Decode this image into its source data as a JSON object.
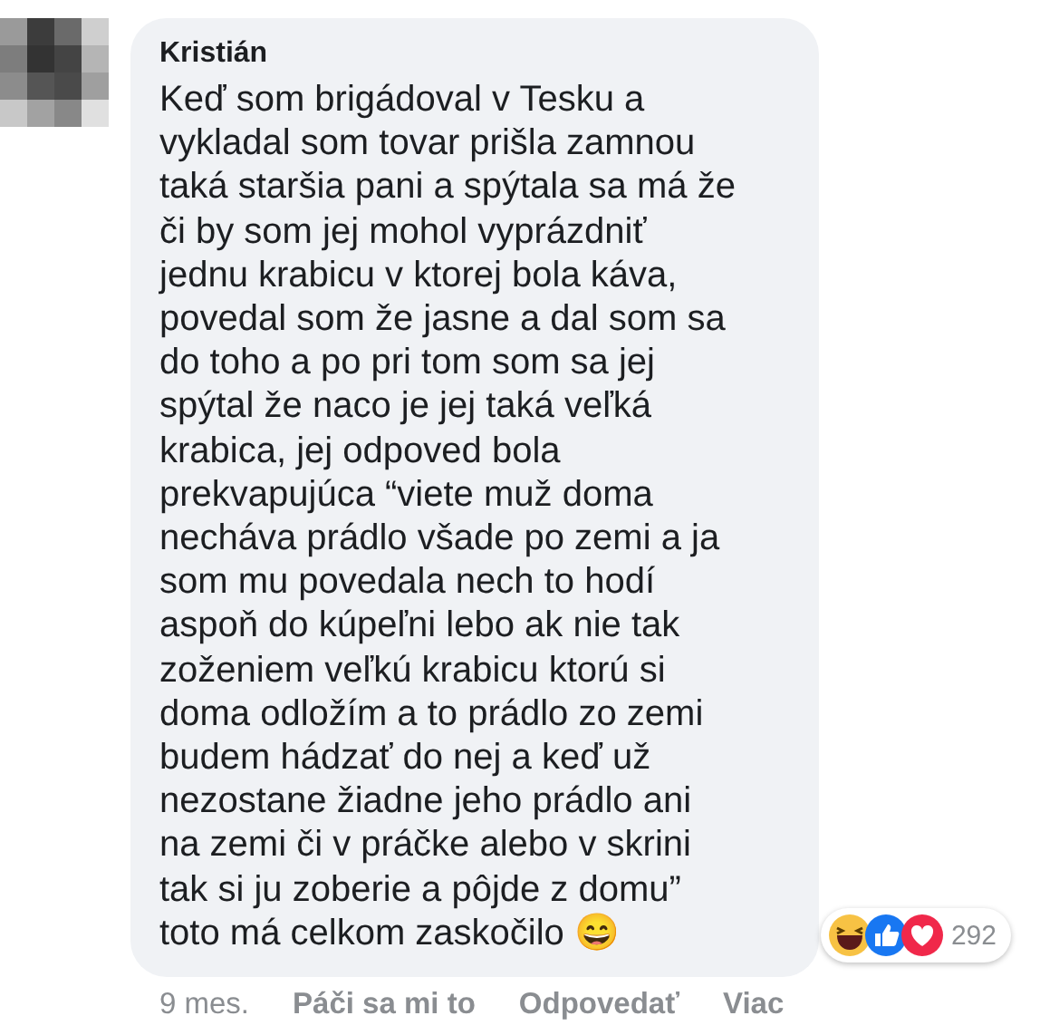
{
  "comment": {
    "author": "Kristián",
    "text": "Keď som brigádoval v Tesku a vykladal som tovar prišla zamnou taká staršia pani a spýtala sa má že či by som jej mohol vyprázdniť jednu krabicu v ktorej bola káva, povedal som že jasne a dal som sa do toho a po pri tom som sa jej spýtal že naco je jej taká veľká krabica, jej odpoved bola prekvapujúca “viete muž doma necháva prádlo všade po zemi a ja som mu povedala nech to hodí aspoň do kúpeľni lebo ak nie tak zoženiem veľkú krabicu ktorú si doma odložím a to prádlo zo zemi budem hádzať do nej a keď už nezostane žiadne jeho prádlo ani na zemi či v práčke alebo v skrini tak si ju zoberie a pôjde z domu” toto má celkom zaskočilo 😄",
    "reactions": {
      "icons": [
        {
          "kind": "haha"
        },
        {
          "kind": "like"
        },
        {
          "kind": "love"
        }
      ],
      "count": "292"
    },
    "time": "9 mes.",
    "actions": [
      "Páči sa mi to",
      "Odpovedať",
      "Viac"
    ]
  }
}
